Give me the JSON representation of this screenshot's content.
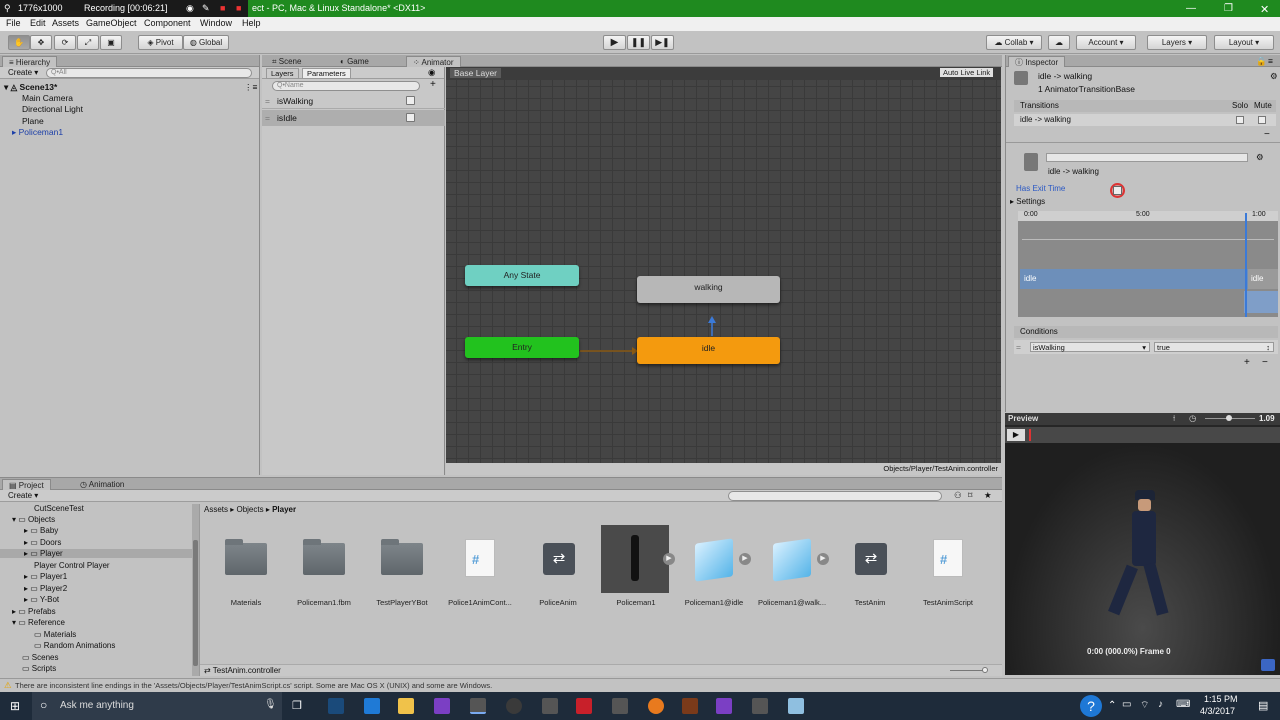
{
  "titlebar": {
    "recorder_size": "1776x1000",
    "recording": "Recording [00:06:21]",
    "title": "ect - PC, Mac & Linux Standalone* <DX11>"
  },
  "menu": [
    "File",
    "Edit",
    "Assets",
    "GameObject",
    "Component",
    "Window",
    "Help"
  ],
  "toolbar": {
    "pivot": "Pivot",
    "global": "Global",
    "collab": "Collab",
    "account": "Account",
    "layers": "Layers",
    "layout": "Layout"
  },
  "hierarchy": {
    "tab": "Hierarchy",
    "create": "Create",
    "search_placeholder": "Q•All",
    "scene": "Scene13*",
    "items": [
      "Main Camera",
      "Directional Light",
      "Plane",
      "Policeman1"
    ]
  },
  "center_tabs": [
    "Scene",
    "Game",
    "Animator"
  ],
  "animator": {
    "tabs": [
      "Layers",
      "Parameters"
    ],
    "search_placeholder": "Q•Name",
    "parameters": [
      "isWalking",
      "isIdle"
    ],
    "breadcrumb": "Base Layer",
    "auto_live_link": "Auto Live Link",
    "nodes": {
      "any_state": "Any State",
      "entry": "Entry",
      "walking": "walking",
      "idle": "idle"
    },
    "path": "Objects/Player/TestAnim.controller"
  },
  "inspector": {
    "tab": "Inspector",
    "title": "idle -> walking",
    "subtitle": "1 AnimatorTransitionBase",
    "transitions_label": "Transitions",
    "solo": "Solo",
    "mute": "Mute",
    "transition_item": "idle -> walking",
    "transition_name": "idle -> walking",
    "has_exit_time": "Has Exit Time",
    "settings": "Settings",
    "timeline_ticks": [
      "0:00",
      "5:00",
      "1:00"
    ],
    "timeline_states": [
      "idle",
      "idle"
    ],
    "conditions_label": "Conditions",
    "condition_param": "isWalking",
    "condition_value": "true"
  },
  "preview": {
    "label": "Preview",
    "speed": "1.09",
    "frame": "0:00 (000.0%) Frame 0"
  },
  "project": {
    "tabs": [
      "Project",
      "Animation"
    ],
    "create": "Create",
    "tree": [
      "CutSceneTest",
      "Objects",
      "Baby",
      "Doors",
      "Player",
      "Player Control Player",
      "Player1",
      "Player2",
      "Y-Bot",
      "Prefabs",
      "Reference",
      "Materials",
      "Random Animations",
      "Scenes",
      "Scripts"
    ],
    "breadcrumb": [
      "Assets",
      "Objects",
      "Player"
    ],
    "assets": [
      "Materials",
      "Policeman1.fbm",
      "TestPlayerYBot",
      "Police1AnimCont...",
      "PoliceAnim",
      "Policeman1",
      "Policeman1@idle",
      "Policeman1@walk...",
      "TestAnim",
      "TestAnimScript"
    ],
    "selected_file": "TestAnim.controller"
  },
  "status": "There are inconsistent line endings in the 'Assets/Objects/Player/TestAnimScript.cs' script. Some are Mac OS X (UNIX) and some are Windows.",
  "taskbar": {
    "search": "Ask me anything",
    "time": "1:15 PM",
    "date": "4/3/2017"
  },
  "colors": {
    "entry": "#22c21e",
    "any_state": "#6fd0c2",
    "idle": "#f49a0e",
    "walking": "#b7b7b7"
  }
}
